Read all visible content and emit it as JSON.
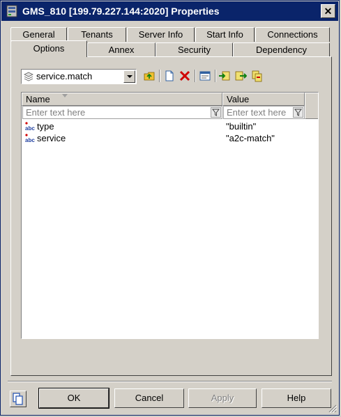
{
  "window": {
    "title": "GMS_810 [199.79.227.144:2020] Properties",
    "close_glyph": "✕"
  },
  "tabs_back": [
    "General",
    "Tenants",
    "Server Info",
    "Start Info",
    "Connections"
  ],
  "tabs_front": [
    "Options",
    "Annex",
    "Security",
    "Dependency"
  ],
  "active_tab": "Options",
  "options": {
    "section_select": "service.match",
    "toolbar": [
      "up-folder-icon",
      "new-icon",
      "delete-icon",
      "properties-icon",
      "import-icon",
      "export-icon",
      "copy-icon"
    ],
    "grid": {
      "columns": [
        "Name",
        "Value"
      ],
      "filter_placeholder": "Enter text here",
      "rows": [
        {
          "name": "type",
          "value": "\"builtin\"",
          "type_icon": "abc"
        },
        {
          "name": "service",
          "value": "\"a2c-match\"",
          "type_icon": "abc"
        }
      ]
    }
  },
  "buttons": {
    "ok": "OK",
    "cancel": "Cancel",
    "apply": "Apply",
    "help": "Help"
  },
  "colors": {
    "titlebar": "#0a246a",
    "face": "#d4d0c8",
    "delete_red": "#d00000"
  }
}
